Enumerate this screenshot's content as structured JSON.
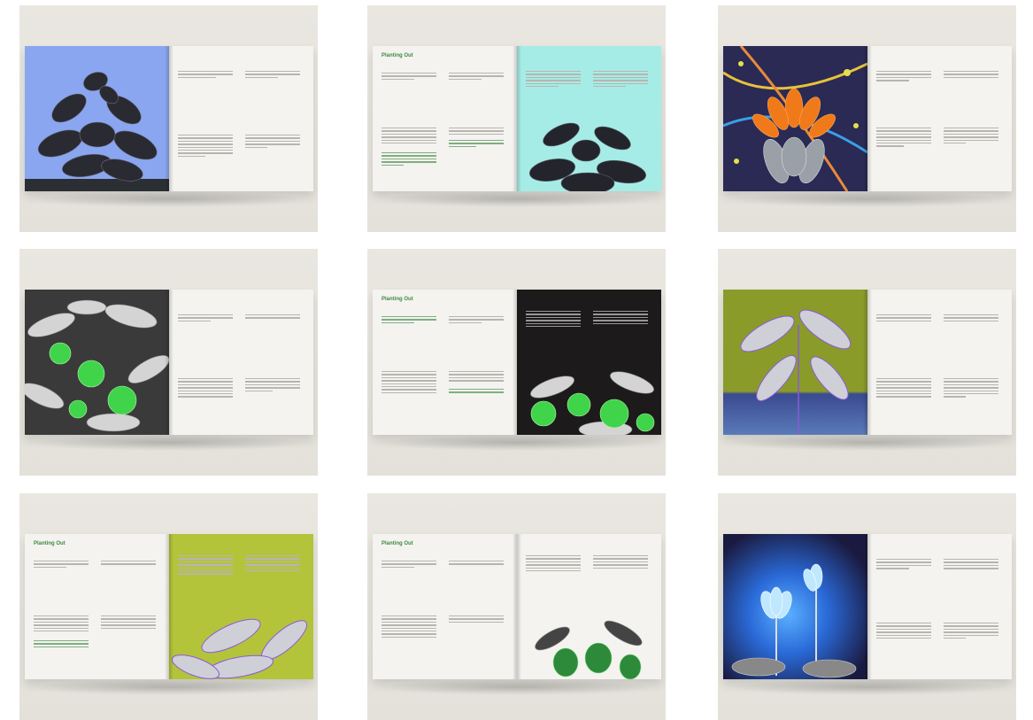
{
  "mockups": [
    {
      "id": "r1c1",
      "layout": "art-left",
      "art": "basil-blue",
      "header": "",
      "page": ""
    },
    {
      "id": "r1c2",
      "layout": "art-right",
      "art": "basil-cyan",
      "header": "Planting Out",
      "page": ""
    },
    {
      "id": "r1c3",
      "layout": "art-left",
      "art": "protea-fireworks",
      "header": "",
      "page": ""
    },
    {
      "id": "r2c1",
      "layout": "art-left",
      "art": "periwinkle-green",
      "header": "",
      "page": ""
    },
    {
      "id": "r2c2",
      "layout": "art-right",
      "art": "periwinkle-dark",
      "header": "Planting Out",
      "page": ""
    },
    {
      "id": "r2c3",
      "layout": "art-left",
      "art": "calathea-olive",
      "header": "",
      "page": ""
    },
    {
      "id": "r3c1",
      "layout": "art-right",
      "art": "calathea-lime",
      "header": "Planting Out",
      "page": ""
    },
    {
      "id": "r3c2",
      "layout": "art-right",
      "art": "berries-white",
      "header": "Planting Out",
      "page": ""
    },
    {
      "id": "r3c3",
      "layout": "art-left",
      "art": "lotus-blue",
      "header": "",
      "page": ""
    }
  ],
  "colors": {
    "background": "#e6e4dd",
    "paper": "#f4f3f0",
    "accent_green": "#3e8a3e",
    "sky_blue": "#8aa6f0",
    "cyan": "#a6ece6",
    "olive": "#8a9b2a",
    "lime": "#b4c43a",
    "dark": "#1c1a1a"
  }
}
